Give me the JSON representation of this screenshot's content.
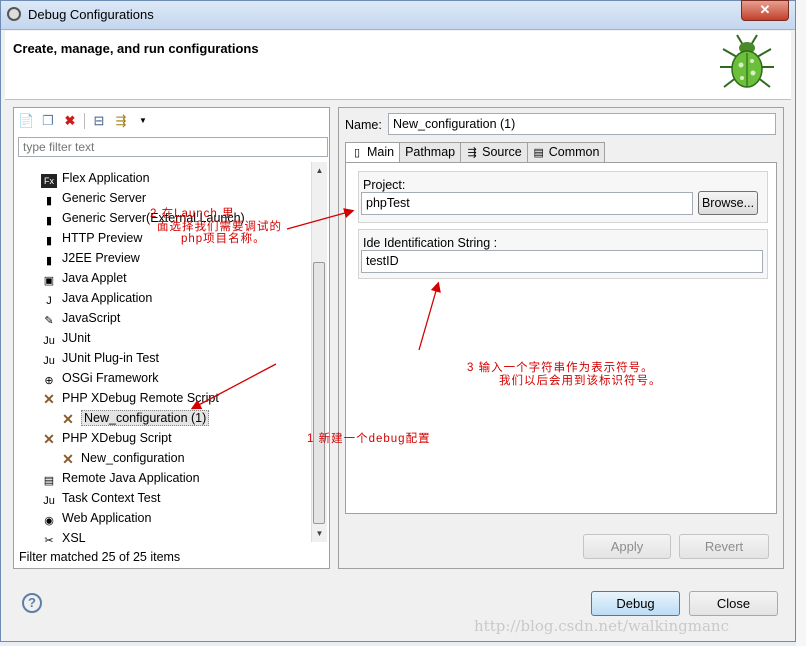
{
  "window": {
    "title": "Debug Configurations",
    "close_glyph": "✕"
  },
  "header": {
    "title": "Create, manage, and run configurations",
    "icon": "bug-icon"
  },
  "left": {
    "toolbar": [
      "new-configuration-icon",
      "duplicate-icon",
      "delete-icon",
      "collapse-all-icon",
      "filter-icon",
      "view-menu-icon"
    ],
    "filter_placeholder": "type filter text",
    "items": [
      {
        "label": "Flex Application",
        "icon": "Fx",
        "indent": 0
      },
      {
        "label": "Generic Server",
        "icon": "▮",
        "indent": 0
      },
      {
        "label": "Generic Server(External Launch)",
        "icon": "▮",
        "indent": 0
      },
      {
        "label": "HTTP Preview",
        "icon": "▮",
        "indent": 0
      },
      {
        "label": "J2EE Preview",
        "icon": "▮",
        "indent": 0
      },
      {
        "label": "Java Applet",
        "icon": "▣",
        "indent": 0
      },
      {
        "label": "Java Application",
        "icon": "J",
        "indent": 0
      },
      {
        "label": "JavaScript",
        "icon": "✎",
        "indent": 0
      },
      {
        "label": "JUnit",
        "icon": "Ju",
        "indent": 0
      },
      {
        "label": "JUnit Plug-in Test",
        "icon": "Ju",
        "indent": 0
      },
      {
        "label": "OSGi Framework",
        "icon": "⊕",
        "indent": 0
      },
      {
        "label": "PHP XDebug Remote Script",
        "icon": "✕",
        "indent": 0
      },
      {
        "label": "New_configuration (1)",
        "icon": "✕",
        "indent": 1,
        "selected": true
      },
      {
        "label": "PHP XDebug Script",
        "icon": "✕",
        "indent": 0
      },
      {
        "label": "New_configuration",
        "icon": "✕",
        "indent": 1
      },
      {
        "label": "Remote Java Application",
        "icon": "▤",
        "indent": 0
      },
      {
        "label": "Task Context Test",
        "icon": "Ju",
        "indent": 0
      },
      {
        "label": "Web Application",
        "icon": "◉",
        "indent": 0
      },
      {
        "label": "XSL",
        "icon": "✂",
        "indent": 0
      }
    ],
    "status": "Filter matched 25 of 25 items"
  },
  "right": {
    "name_label": "Name:",
    "name_value": "New_configuration (1)",
    "tabs": [
      {
        "label": "Main",
        "icon": "▯",
        "active": true
      },
      {
        "label": "Pathmap",
        "icon": "",
        "active": false
      },
      {
        "label": "Source",
        "icon": "⇶",
        "active": false
      },
      {
        "label": "Common",
        "icon": "▤",
        "active": false
      }
    ],
    "project_label": "Project:",
    "project_value": "phpTest",
    "browse_label": "Browse...",
    "ide_label": "Ide Identification String :",
    "ide_value": "testID",
    "apply_label": "Apply",
    "revert_label": "Revert"
  },
  "footer": {
    "help_glyph": "?",
    "debug_label": "Debug",
    "close_label": "Close"
  },
  "annotations": {
    "note2_line1": "2 在Launch 里",
    "note2_line2": "面选择我们需要调试的",
    "note2_line3": "php项目名称。",
    "note3_line1": "3 输入一个字符串作为表示符号。",
    "note3_line2": "我们以后会用到该标识符号。",
    "note1": "1 新建一个debug配置"
  },
  "watermark": "http://blog.csdn.net/walkingmanc",
  "colors": {
    "annotation": "#d40000",
    "accent": "#3c7fb1"
  }
}
